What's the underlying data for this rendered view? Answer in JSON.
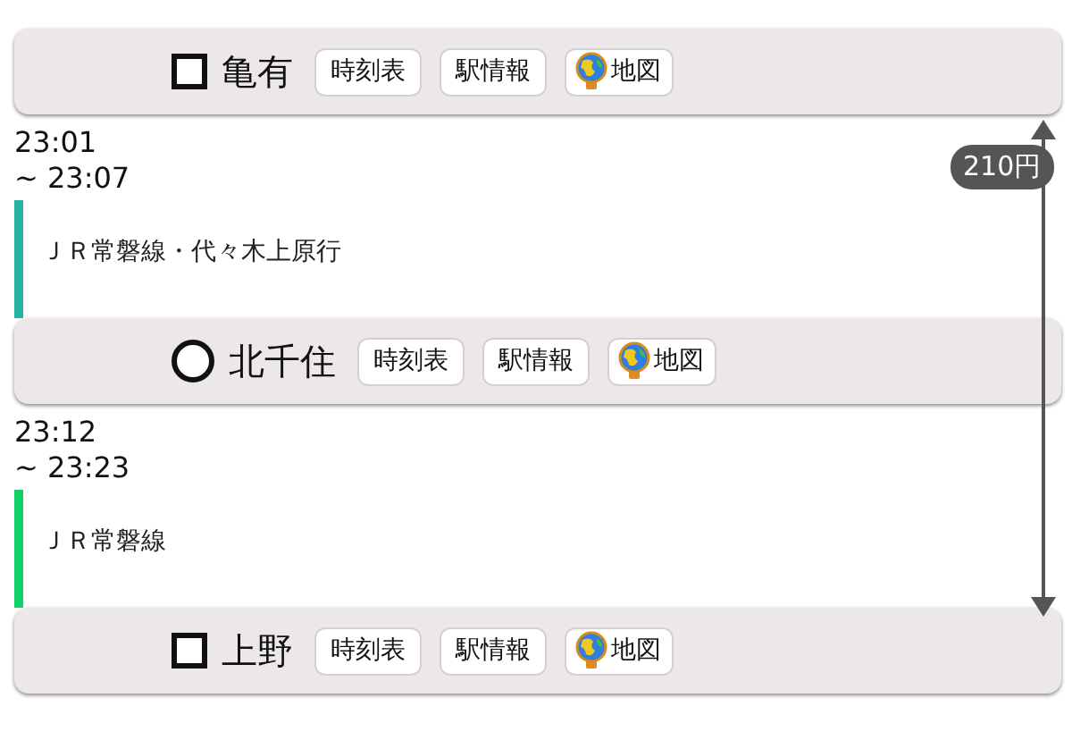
{
  "route": [
    {
      "kind": "endpoint_station",
      "name": "亀有",
      "buttons": [
        "時刻表",
        "駅情報",
        "地図"
      ]
    },
    {
      "kind": "segment",
      "depart": "23:01",
      "arrive": "~ 23:07",
      "line": "ＪＲ常磐線・代々木上原行",
      "color": "#26b3a0"
    },
    {
      "kind": "transfer_station",
      "name": "北千住",
      "buttons": [
        "時刻表",
        "駅情報",
        "地図"
      ]
    },
    {
      "kind": "segment",
      "depart": "23:12",
      "arrive": "~ 23:23",
      "line": "ＪＲ常磐線",
      "color": "#12d068"
    },
    {
      "kind": "endpoint_station",
      "name": "上野",
      "buttons": [
        "時刻表",
        "駅情報",
        "地図"
      ]
    }
  ],
  "fare": {
    "label": "210円"
  }
}
